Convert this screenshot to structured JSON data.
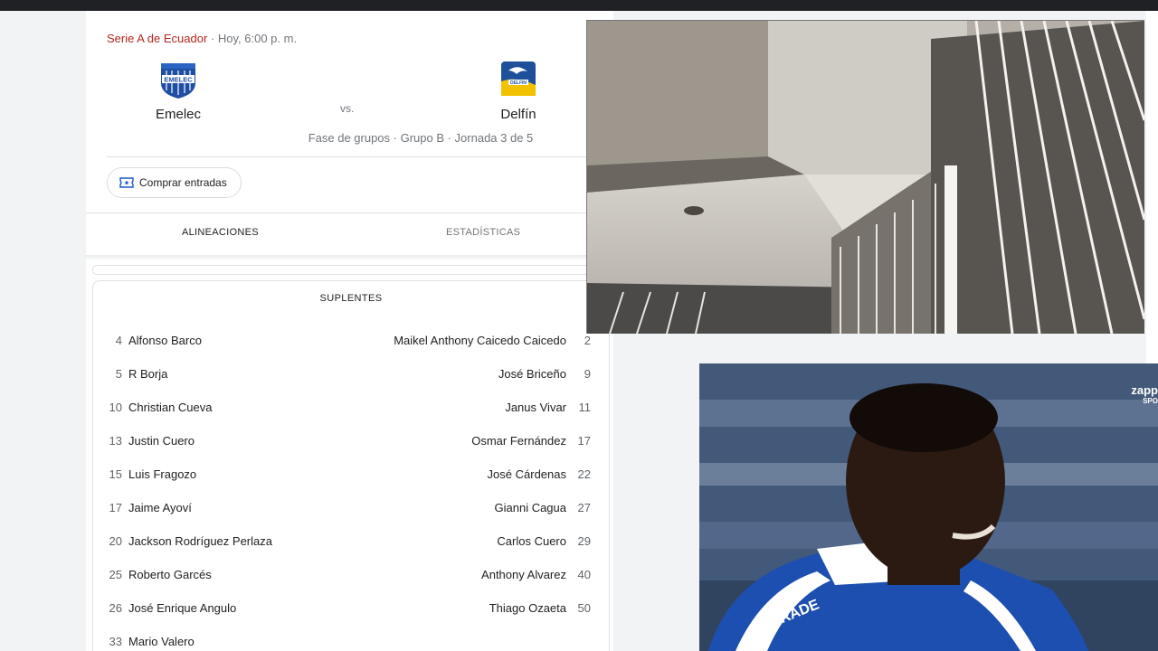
{
  "match": {
    "league": "Serie A de Ecuador",
    "separator": " · ",
    "datetime": "Hoy, 6:00 p. m.",
    "home_team": "Emelec",
    "away_team": "Delfín",
    "vs_label": "vs.",
    "stage": "Fase de grupos · Grupo B · Jornada 3 de 5",
    "tickets_label": "Comprar entradas",
    "home_logo_text": "EMELEC",
    "away_logo_text": "DELFIN"
  },
  "tabs": [
    {
      "label": "ALINEACIONES",
      "active": true
    },
    {
      "label": "ESTADÍSTICAS",
      "active": false
    }
  ],
  "substitutes": {
    "title": "SUPLENTES",
    "rows": [
      {
        "home_num": "4",
        "home_name": "Alfonso Barco",
        "away_name": "Maikel Anthony Caicedo Caicedo",
        "away_num": "2"
      },
      {
        "home_num": "5",
        "home_name": "R Borja",
        "away_name": "José Briceño",
        "away_num": "9"
      },
      {
        "home_num": "10",
        "home_name": "Christian Cueva",
        "away_name": "Janus Vivar",
        "away_num": "11"
      },
      {
        "home_num": "13",
        "home_name": "Justin Cuero",
        "away_name": "Osmar Fernández",
        "away_num": "17"
      },
      {
        "home_num": "15",
        "home_name": "Luis Fragozo",
        "away_name": "José Cárdenas",
        "away_num": "22"
      },
      {
        "home_num": "17",
        "home_name": "Jaime Ayoví",
        "away_name": "Gianni Cagua",
        "away_num": "27"
      },
      {
        "home_num": "20",
        "home_name": "Jackson Rodríguez Perlaza",
        "away_name": "Carlos Cuero",
        "away_num": "29"
      },
      {
        "home_num": "25",
        "home_name": "Roberto Garcés",
        "away_name": "Anthony Alvarez",
        "away_num": "40"
      },
      {
        "home_num": "26",
        "home_name": "José Enrique Angulo",
        "away_name": "Thiago Ozaeta",
        "away_num": "50"
      },
      {
        "home_num": "33",
        "home_name": "Mario Valero",
        "away_name": "",
        "away_num": ""
      }
    ]
  },
  "video_overlay": {
    "watermark": "zapp",
    "watermark_sub": "SPO",
    "jersey_sponsor": "SPORADE"
  },
  "colors": {
    "league_red": "#b3261e",
    "emelec_blue": "#1f4fa3",
    "delfin_yellow": "#f2c200",
    "jersey_blue": "#1d4fb0"
  }
}
